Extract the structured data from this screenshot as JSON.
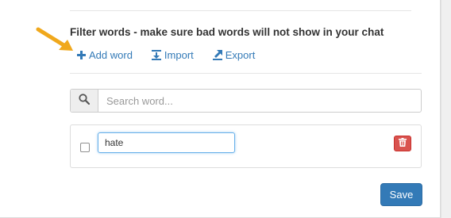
{
  "filter": {
    "title": "Filter words - make sure bad words will not show in your chat",
    "actions": {
      "add_label": "Add word",
      "import_label": "Import",
      "export_label": "Export"
    }
  },
  "search": {
    "placeholder": "Search word...",
    "icon": "search-icon"
  },
  "words": [
    {
      "value": "hate",
      "checked": false
    }
  ],
  "footer": {
    "save_label": "Save"
  },
  "colors": {
    "link": "#337ab7",
    "primary": "#337ab7",
    "danger": "#d9534f",
    "annotation_arrow": "#f0a81c"
  }
}
